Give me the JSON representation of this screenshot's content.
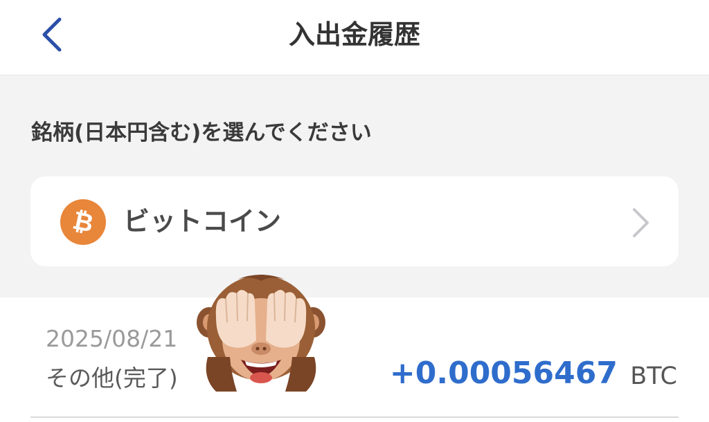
{
  "header": {
    "title": "入出金履歴",
    "back_icon": "chevron-left-icon"
  },
  "selector": {
    "label": "銘柄(日本円含む)を選んでください",
    "coin_name": "ビットコイン",
    "coin_icon": "bitcoin-icon",
    "coin_symbol": "₿"
  },
  "transactions": [
    {
      "date": "2025/08/21",
      "status": "その他(完了)",
      "amount": "+0.00056467",
      "unit": "BTC"
    }
  ],
  "colors": {
    "accent_blue": "#2f6dcc",
    "back_chevron": "#2a4fa8",
    "bitcoin_orange": "#e8863a"
  },
  "overlay": {
    "sticker": "see-no-evil-monkey"
  }
}
